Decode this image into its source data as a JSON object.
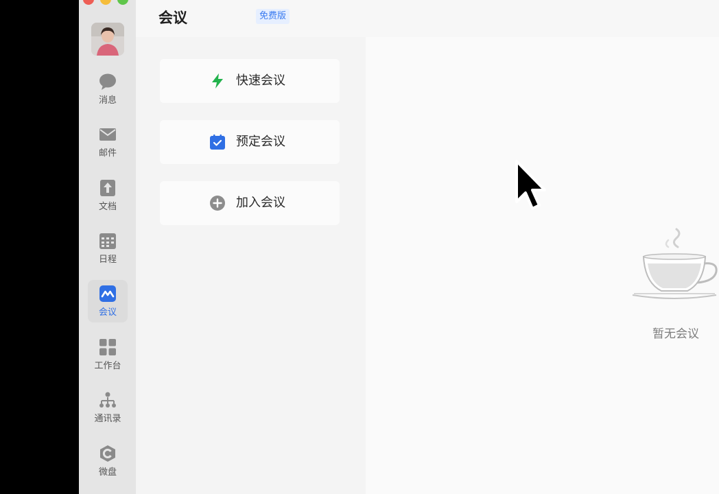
{
  "window": {
    "controls": [
      "close",
      "minimize",
      "maximize"
    ]
  },
  "header": {
    "title": "会议",
    "edition_badge": "免费版"
  },
  "sidebar": {
    "items": [
      {
        "label": "消息",
        "icon": "message-icon"
      },
      {
        "label": "邮件",
        "icon": "mail-icon"
      },
      {
        "label": "文档",
        "icon": "docs-icon"
      },
      {
        "label": "日程",
        "icon": "calendar-icon"
      },
      {
        "label": "会议",
        "icon": "meeting-icon",
        "active": true
      },
      {
        "label": "工作台",
        "icon": "workbench-icon"
      },
      {
        "label": "通讯录",
        "icon": "contacts-icon"
      },
      {
        "label": "微盘",
        "icon": "drive-icon"
      }
    ]
  },
  "actions": [
    {
      "label": "快速会议",
      "icon": "lightning-icon"
    },
    {
      "label": "预定会议",
      "icon": "calendar-check-icon"
    },
    {
      "label": "加入会议",
      "icon": "plus-circle-icon"
    }
  ],
  "main": {
    "empty_text": "暂无会议",
    "empty_icon": "coffee-cup-icon"
  },
  "colors": {
    "accent": "#2f6fe4",
    "quick_meeting": "#22b24c",
    "sidebar_bg": "#e5e5e5"
  }
}
